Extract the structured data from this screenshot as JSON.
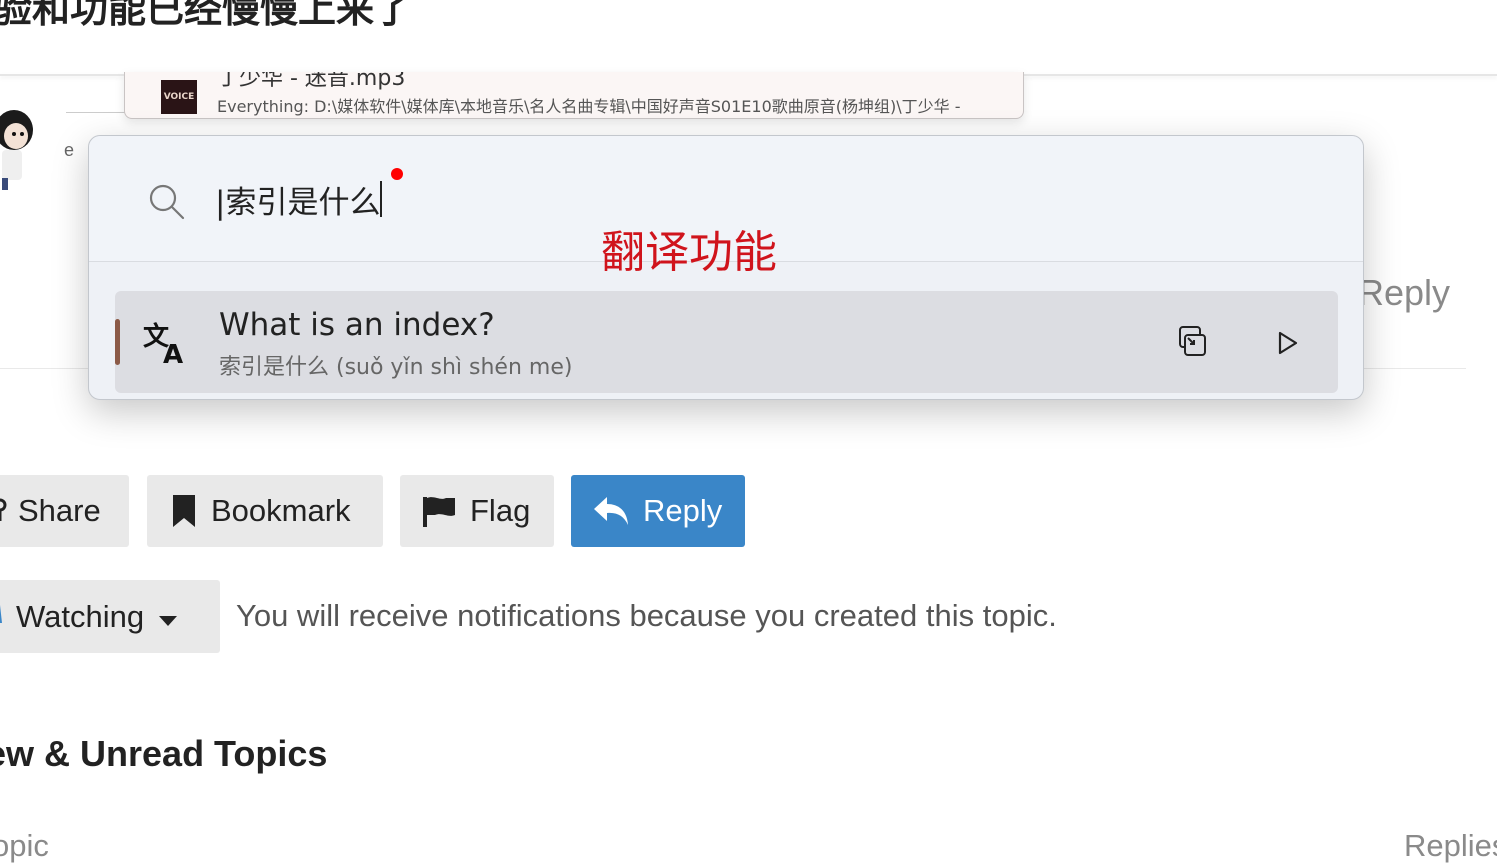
{
  "page": {
    "topic_title": "验和功能已经慢慢上来了",
    "small_text": "e",
    "bg_reply_link": "Reply",
    "buttons": {
      "share": "Share",
      "bookmark": "Bookmark",
      "flag": "Flag",
      "reply": "Reply"
    },
    "watching": {
      "label": "Watching",
      "note": "You will receive notifications because you created this topic."
    },
    "section_title": "ew & Unread Topics",
    "columns": {
      "topic": "opic",
      "replies": "Replies"
    },
    "colors": {
      "reply_button": "#3a86c8",
      "button_bg": "#e9e9e9"
    }
  },
  "everything_popup": {
    "file_name": "丁少华 - 迷音.mp3",
    "path": "Everything: D:\\媒体软件\\媒体库\\本地音乐\\名人名曲专辑\\中国好声音S01E10歌曲原音(杨坤组)\\丁少华 -",
    "thumb_text": "VOICE"
  },
  "launcher": {
    "search": {
      "value": "|索引是什么",
      "icon": "search-icon"
    },
    "annotation": "翻译功能",
    "result": {
      "icon": "translate-icon",
      "title": "What is an index?",
      "subtitle": "索引是什么 (suǒ yǐn shì shén me)",
      "actions": [
        "copy-icon",
        "play-icon"
      ]
    },
    "colors": {
      "annotation": "#d0141c",
      "accent": "#8b5a47",
      "indicator_dot": "#ff0000"
    }
  }
}
